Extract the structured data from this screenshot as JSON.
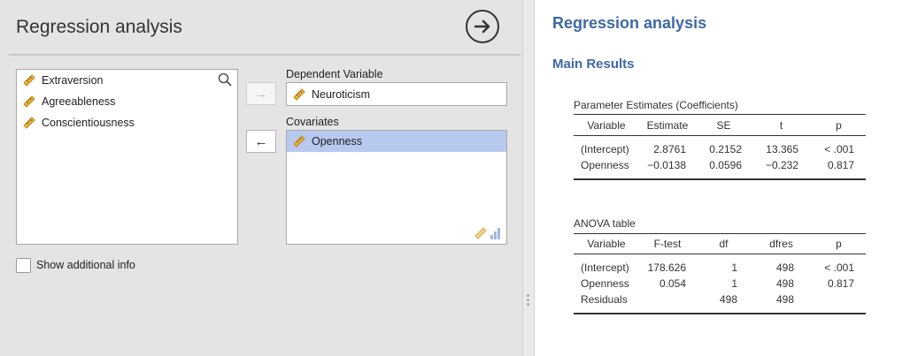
{
  "left_panel": {
    "title": "Regression analysis",
    "available_variables": [
      "Extraversion",
      "Agreeableness",
      "Conscientiousness"
    ],
    "dependent_label": "Dependent Variable",
    "dependent_value": "Neuroticism",
    "covariates_label": "Covariates",
    "covariates": [
      "Openness"
    ],
    "show_additional_info": "Show additional info",
    "show_additional_checked": false,
    "move_right_arrow": "→",
    "move_left_arrow": "←"
  },
  "results": {
    "title": "Regression analysis",
    "subtitle": "Main Results",
    "param_table": {
      "caption": "Parameter Estimates (Coefficients)",
      "columns": [
        "Variable",
        "Estimate",
        "SE",
        "t",
        "p"
      ],
      "rows": [
        [
          "(Intercept)",
          "2.8761",
          "0.2152",
          "13.365",
          "< .001"
        ],
        [
          "Openness",
          "−0.0138",
          "0.0596",
          "−0.232",
          "0.817"
        ]
      ]
    },
    "anova_table": {
      "caption": "ANOVA table",
      "columns": [
        "Variable",
        "F-test",
        "df",
        "dfres",
        "p"
      ],
      "rows": [
        [
          "(Intercept)",
          "178.626",
          "1",
          "498",
          "< .001"
        ],
        [
          "Openness",
          "0.054",
          "1",
          "498",
          "0.817"
        ],
        [
          "Residuals",
          "",
          "498",
          "498",
          ""
        ]
      ]
    }
  },
  "colors": {
    "accent": "#3f68a6",
    "selection": "#b7c9ee",
    "panel": "#e4e4e4",
    "ruler": "#f0b840"
  }
}
